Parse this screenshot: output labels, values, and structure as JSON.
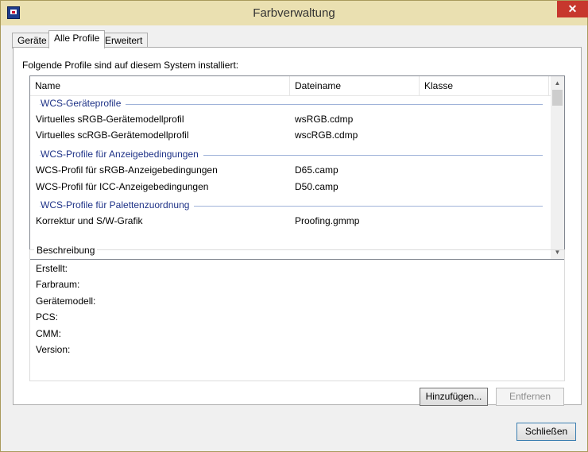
{
  "window": {
    "title": "Farbverwaltung",
    "close_label": "✕"
  },
  "tabs": [
    {
      "label": "Geräte"
    },
    {
      "label": "Alle Profile"
    },
    {
      "label": "Erweitert"
    }
  ],
  "panel": {
    "intro": "Folgende Profile sind auf diesem System installiert:",
    "columns": [
      "Name",
      "Dateiname",
      "Klasse"
    ],
    "groups": [
      {
        "label": "WCS-Geräteprofile",
        "rows": [
          {
            "name": "Virtuelles sRGB-Gerätemodellprofil",
            "file": "wsRGB.cdmp",
            "class": ""
          },
          {
            "name": "Virtuelles scRGB-Gerätemodellprofil",
            "file": "wscRGB.cdmp",
            "class": ""
          }
        ]
      },
      {
        "label": "WCS-Profile für Anzeigebedingungen",
        "rows": [
          {
            "name": "WCS-Profil für sRGB-Anzeigebedingungen",
            "file": "D65.camp",
            "class": ""
          },
          {
            "name": "WCS-Profil für ICC-Anzeigebedingungen",
            "file": "D50.camp",
            "class": ""
          }
        ]
      },
      {
        "label": "WCS-Profile für Palettenzuordnung",
        "rows": [
          {
            "name": "Korrektur und S/W-Grafik",
            "file": "Proofing.gmmp",
            "class": ""
          }
        ]
      }
    ],
    "scroll_up": "▲",
    "scroll_down": "▼"
  },
  "description": {
    "title": "Beschreibung",
    "fields": [
      "Erstellt:",
      "Farbraum:",
      "Gerätemodell:",
      "PCS:",
      "CMM:",
      "Version:"
    ]
  },
  "buttons": {
    "add": "Hinzufügen...",
    "remove": "Entfernen",
    "close": "Schließen"
  }
}
